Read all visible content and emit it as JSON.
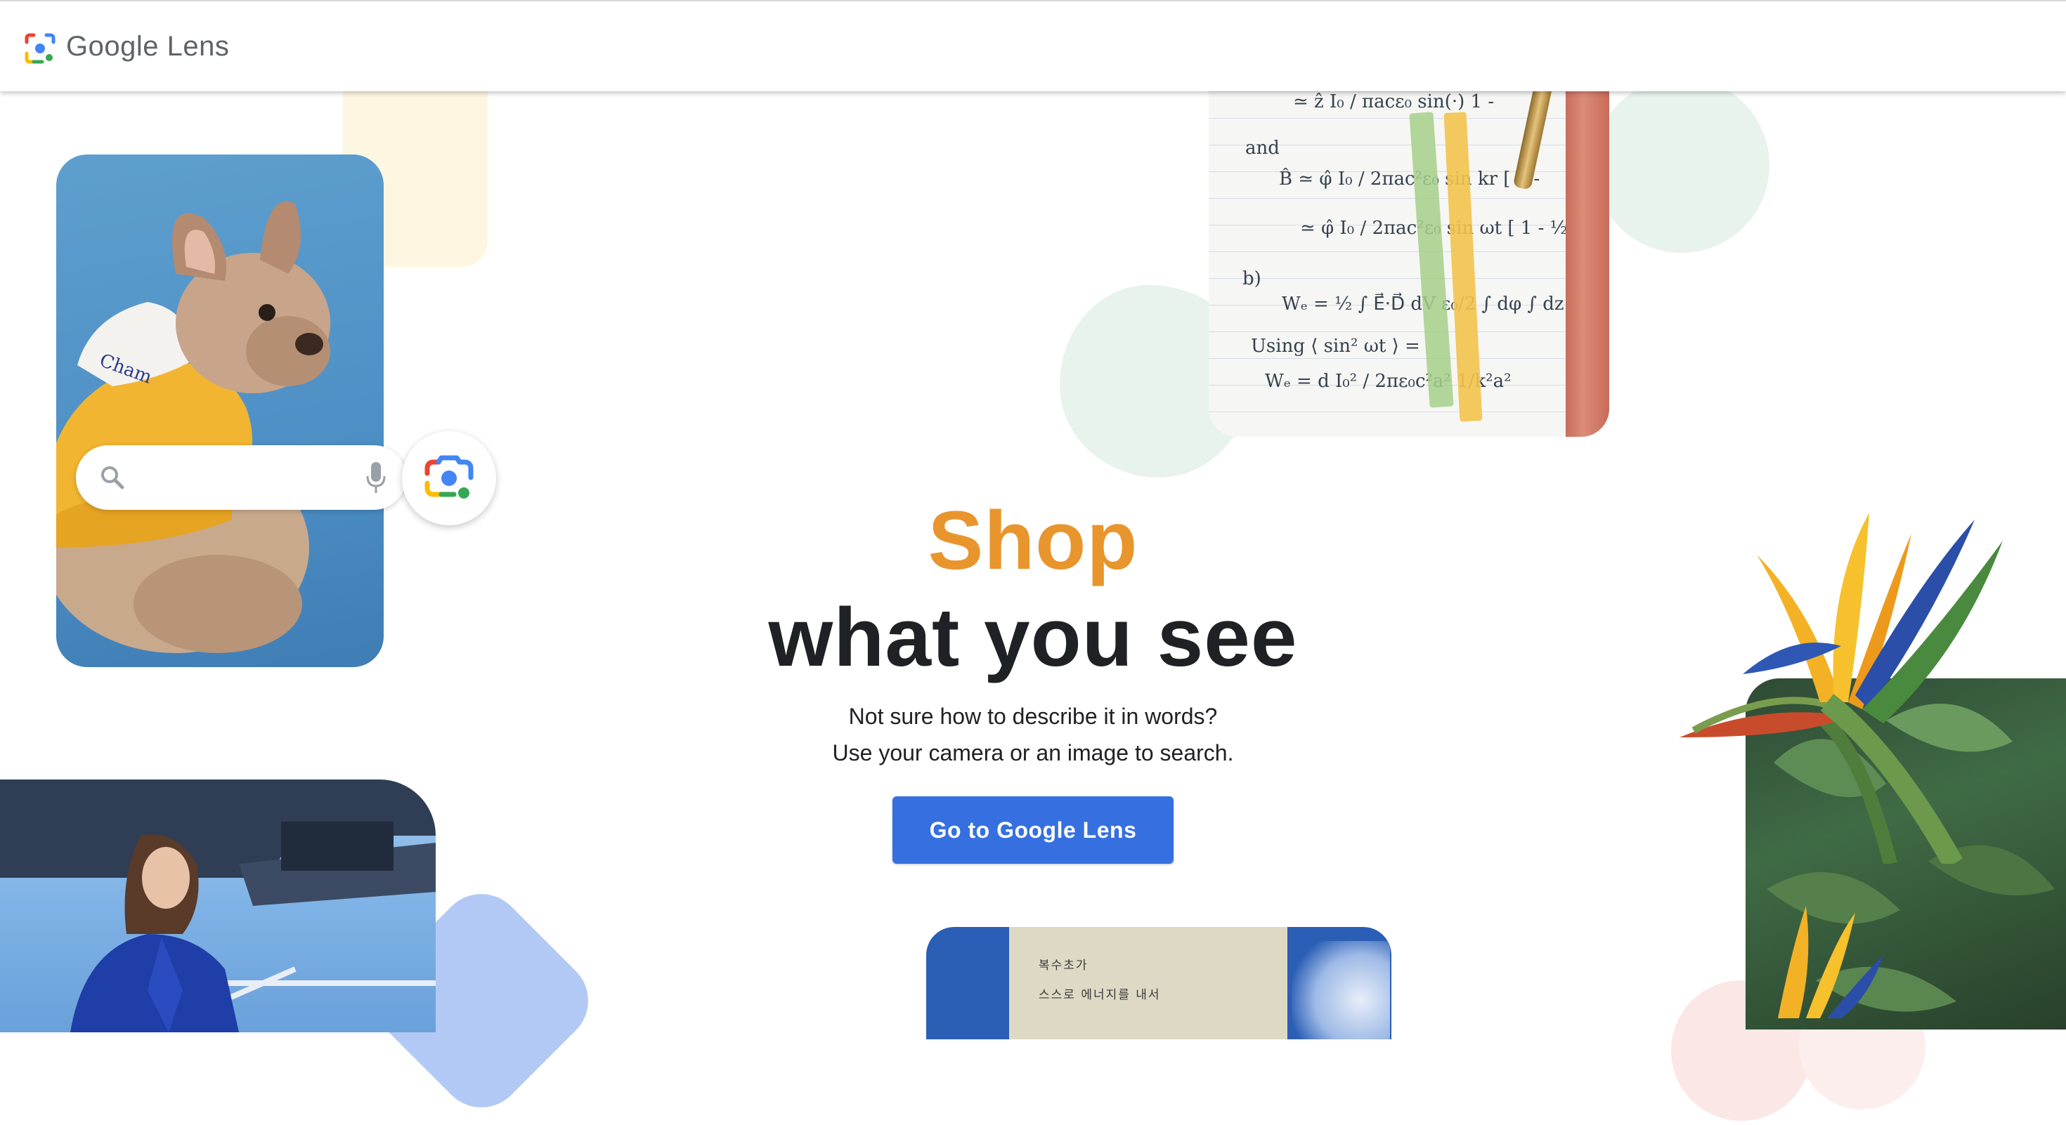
{
  "header": {
    "logo_google": "Google",
    "logo_lens": "Lens",
    "logo_icon": "google-lens-icon"
  },
  "hero": {
    "title_accent": "Shop",
    "title_main": "what you see",
    "subtitle_line1": "Not sure how to describe it in words?",
    "subtitle_line2": "Use your camera or an image to search.",
    "cta_label": "Go to Google Lens"
  },
  "search_mock": {
    "search_icon": "search-icon",
    "mic_icon": "microphone-icon",
    "lens_icon": "google-lens-icon"
  },
  "notes": {
    "lines": [
      "≃ ẑ  I₀ / πacε₀   sin(·)   1 -",
      "and",
      "B̂ ≃ φ̂  I₀ / 2πac²ε₀   sin  kr  [ 1 -",
      "≃ φ̂  I₀ / 2πac²ε₀   sin ωt   [ 1 - ½",
      "b)",
      "Wₑ = ½ ∫ E⃗·D⃗ dV   ε₀/2 ∫ dφ ∫ dz",
      "Using   ⟨ sin² ωt ⟩ =",
      "Wₑ =  d I₀² / 2πε₀c²a²   1/k²a²"
    ]
  },
  "korean": {
    "line1": "복수초가",
    "line2": "스스로  에너지를  내서"
  },
  "colors": {
    "accent_orange": "#e8952d",
    "cta_blue": "#3670e0",
    "text_dark": "#202124"
  }
}
